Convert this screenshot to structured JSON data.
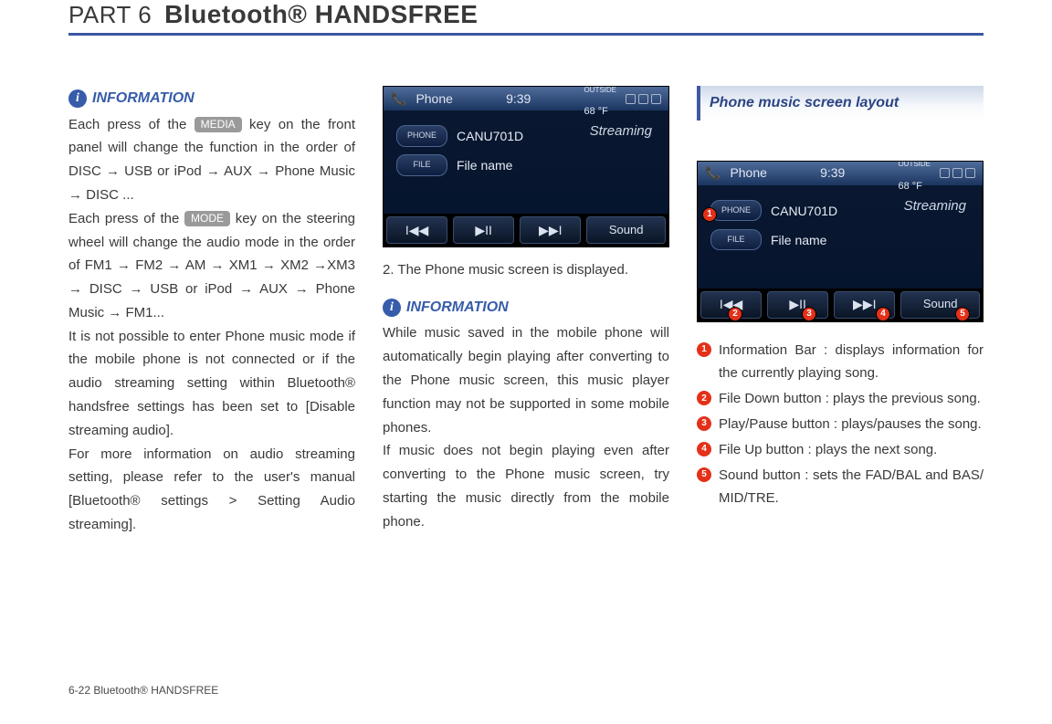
{
  "header": {
    "part_label": "PART 6",
    "part_title": "Bluetooth® HANDSFREE"
  },
  "col1": {
    "info_label": "INFORMATION",
    "p1a": "Each press of the ",
    "key_media": "MEDIA",
    "p1b": " key on the front panel will change the function in the order of DISC → USB or iPod → AUX → Phone Music → DISC  ...",
    "p2a": "Each press of the ",
    "key_mode": "MODE",
    "p2b": " key on the steering wheel will change the audio mode in the order of FM1 → FM2 → AM → XM1 → XM2 →XM3 → DISC → USB or iPod → AUX → Phone Music → FM1...",
    "p3": "It is not possible to enter Phone music mode if the mobile phone is not connected or if the audio streaming setting within Bluetooth® handsfree settings has been set to [Disable streaming audio].",
    "p4": "For more information on audio streaming setting, please refer to the user's manual [Bluetooth® settings > Setting Audio streaming]."
  },
  "col2": {
    "screenshot": {
      "title": "Phone",
      "time": "9:39",
      "outside_label": "OUTSIDE",
      "temp": "68 °F",
      "streaming": "Streaming",
      "row1_tag": "PHONE",
      "row1_val": "CANU701D",
      "row2_tag": "FILE",
      "row2_val": "File name",
      "btn_prev": "I◀◀",
      "btn_play": "▶II",
      "btn_next": "▶▶I",
      "btn_sound": "Sound"
    },
    "caption": "2. The Phone music screen is displayed.",
    "info_label": "INFORMATION",
    "p1": "While music saved in the mobile phone will automatically begin playing after converting to the Phone music screen, this music player function may not be supported in some mobile phones.",
    "p2": "If music does not begin playing even after converting to the Phone music screen, try starting the music directly from the mobile phone."
  },
  "col3": {
    "section_title": "Phone music screen layout",
    "screenshot": {
      "title": "Phone",
      "time": "9:39",
      "outside_label": "OUTSIDE",
      "temp": "68 °F",
      "streaming": "Streaming",
      "row1_tag": "PHONE",
      "row1_val": "CANU701D",
      "row2_tag": "FILE",
      "row2_val": "File name",
      "btn_prev": "I◀◀",
      "btn_play": "▶II",
      "btn_next": "▶▶I",
      "btn_sound": "Sound"
    },
    "badges": [
      "1",
      "2",
      "3",
      "4",
      "5"
    ],
    "list": [
      "Information Bar : displays information for the currently playing song.",
      "File Down button : plays the previous song.",
      "Play/Pause button : plays/pauses the song.",
      "File Up button : plays the next song.",
      "Sound button : sets the FAD/BAL and BAS/ MID/TRE."
    ]
  },
  "footer": "6-22    Bluetooth® HANDSFREE"
}
